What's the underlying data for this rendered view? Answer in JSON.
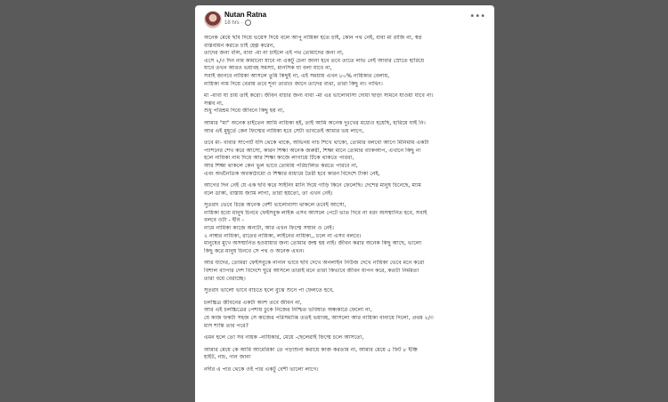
{
  "post": {
    "author": "Nutan Ratna",
    "time": "18 hrs",
    "paragraphs": [
      [
        "অনেক মেয়ে ছবি দিয়ে ভয়েস দিয়ে বলে আপু নায়িকা হতে চাই, কোন পথ নেই, বাবা মা রাজি না, স্বপ্ন",
        "বাস্তবায়ন করতে চাই হেল্প করেন,",
        "তাদের জন্য বলি, বাবা -মা না চাইলে এই পথ তোমাদের জন্য না,",
        "এসে ২/৩ দিন নাম কামানো যাবে না একটু চেনা জানা হবে তবে তাতে লাভ নেই আবার স্রোতে হারিয়ে",
        "যাবে তখন আরও ভয়াবহ সমস্যা, মানসিক যা বলা যাবে না,",
        "সবাই জানবে নায়িকা আসলে তুমি কিছুই না, এই সময়ায় এখন ৮০% নায়িকার বেলায়,",
        "নায়িকা নাম দিয়ে বেরায় তবে শূন্য তারাও জানে তাদের ব্যথা, তারা কিছু না। নাথিং।"
      ],
      [
        "মা -বাবা যা চায় তাই করো। জীবন বাচার জন্য বাবা -মা এর ভালোবাসা দোয়া ছাড়া সামনে যাওয়া যাবে না।",
        "সম্ভব না,",
        "শুধু পরিশ্রম দিয়ে জীবনে কিছু হয় না,"
      ],
      [
        "আমার \"মা\" অনেক চাইতেন আমি নায়িকা হই, তাই আমি অনেক দুঃখের মধ্যেও হয়েছি, হারিয়ে যাই নি।",
        "আর এই মুহূর্তে কেন ফিল্মের নায়িকা হবে সেটা ভাবতেই আমার ভয় লাগে,"
      ],
      [
        "তবে মা- বাবার সাপোর্ট যদি থেকে থাকে, অভিনয় নাচ শিখে থাকো, তোমার বলবো আগে মিনিমাম একটা",
        "প্যাশনের শেখ করে আসো, কারন শিক্ষা অনেক জরুরী, শিক্ষা মানে তোমার ব্যাকআপ, এখানে কিছু না",
        "হলে নায়িকা নাম দিয়ে আর শিক্ষা কাজে লাগায়ে টিকে থাকতে পারবা,",
        "আর শিক্ষা থাকলে কেন ভুল ভাবে তোমায় পরিচালিত করতে পারবে না,",
        "এবং অর্থনৈতিক অবকাঠামো ও শিক্ষার মাধ্যমে তৈরী হবে কারন বিদেশে টাকা নেই,"
      ],
      [
        "আগের দিন নেই যে এক ছবি করে সাইনিং মানি দিয়ে গাড়ি কিনে ফেলেছি। দেশের মানুষ চিনেছে, ম্যাম",
        "বলে ডাকা, রাস্তায় জ্যাম লাগা, তারা হয়তো, তা এখন নেই।"
      ],
      [
        "সুতরাং ভেবে চিন্তে অনেক বেশী ভালোবাসা থাকলে তবেই আসো,",
        "নায়িকা হবো মানুষ চিনবে ফেইসবুক লাইক এসব আসলে পেটে ভাত দিবে না বরং অসম্মানিত হবে, সবাই",
        "বলবে ওটা - ইনি -",
        "নামে নায়িকা কাজে অন্যটা, আর এখন ফিল্মে সম্মান ও নেই।",
        "২ নাম্বার নায়িকা, রাতের নায়িকা, লাইনের নায়িকা,, চলে না এসব বলবে।",
        "মানুষের মুখে অসম্মানিত হওয়ায়ার জন্য তোমার জন্ম হয় নাই। জীবন করার অনেক কিছু আছে, ভালো",
        "কিছু করে মানুষ চিনবে সে পথ ও অনেক এখন।"
      ],
      [
        "আর যাদের, তোমরা ফেইসবুকে নানান ভাবে ছবি দেখে অনলাইন নিউজ দেখে নায়িকা ভেবে মনে করো",
        "বিশাল ব্যাপার দেশ বিদেশে ঘুরে আসলে তারাই মনে তারা কিভাবে জীবন যাপন করে, কতটা নির্মমতা",
        "তারা বয়ে বেরাচ্ছে।"
      ],
      [
        "সুতরাং ভালো ভাবে বাচতে হলে বুঝে শুনে পা ফেলতে হবে,"
      ],
      [
        "চলচ্চিত্র জীবনের একটা অংশ তবে জীবন না,",
        "আর এই চলচ্চিত্রের পেশায় ঢুকে নিজের নিশ্চিত ভবিষ্যত অন্ধকারে ফেলো না,",
        "যে কাজ ফকটা সহজ সে কাজের পরিসমাপ্তি ততই ভয়াবহ, আসলো আর নায়িকা বানায়ে দিলো, প্রথম ২/৩",
        "মাস শান্তি তার পরে?"
      ],
      [
        "এমন হলে তো সব নায়ক -নায়িকার, মেয়ে -ছেলেরাই ফিল্মে চলে আসতো,"
      ],
      [
        "আমার মেয়ে কে আমি আমেরিকা তে পড়াশুনা করায়ে কাজ করতাম না, আমার মেয়ে ৫ ফিট ৮ ইঞ্চি",
        "হাইট, নাচ, গান জানা"
      ],
      [
        "নদীর এ পার থেকে ওই পার একটু বেশী ভালো লাগে।"
      ]
    ]
  }
}
